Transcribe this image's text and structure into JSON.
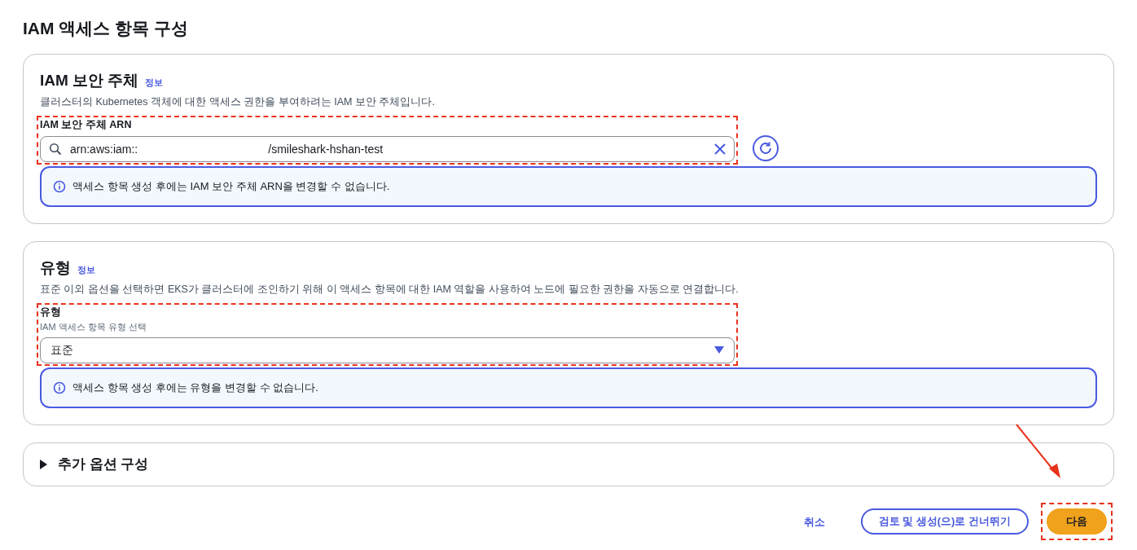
{
  "page_title": "IAM 액세스 항목 구성",
  "principal": {
    "title": "IAM 보안 주체",
    "info": "정보",
    "description": "클러스터의 Kubernetes 객체에 대한 액세스 권한을 부여하려는 IAM 보안 주체입니다.",
    "field": {
      "label": "IAM 보안 주체 ARN",
      "value_start": "arn:aws:iam::",
      "value_end": "/smileshark-hshan-test",
      "highlighted": true
    },
    "alert": "액세스 항목 생성 후에는 IAM 보안 주체 ARN을 변경할 수 없습니다."
  },
  "type_section": {
    "title": "유형",
    "info": "정보",
    "description": "표준 이외 옵션을 선택하면 EKS가 클러스터에 조인하기 위해 이 액세스 항목에 대한 IAM 역할을 사용하여 노드에 필요한 권한을 자동으로 연결합니다.",
    "field": {
      "label": "유형",
      "hint": "IAM 액세스 항목 유형 선택",
      "value": "표준",
      "highlighted": true
    },
    "alert": "액세스 항목 생성 후에는 유형을 변경할 수 없습니다."
  },
  "additional": {
    "title": "추가 옵션 구성",
    "expanded": false
  },
  "buttons": [
    {
      "label": "취소",
      "kind": "link",
      "highlighted": false
    },
    {
      "label": "검토 및 생성(으)로 건너뛰기",
      "kind": "secondary",
      "highlighted": false
    },
    {
      "label": "다음",
      "kind": "primary",
      "highlighted": true
    }
  ],
  "arrow_to_highlight": true
}
